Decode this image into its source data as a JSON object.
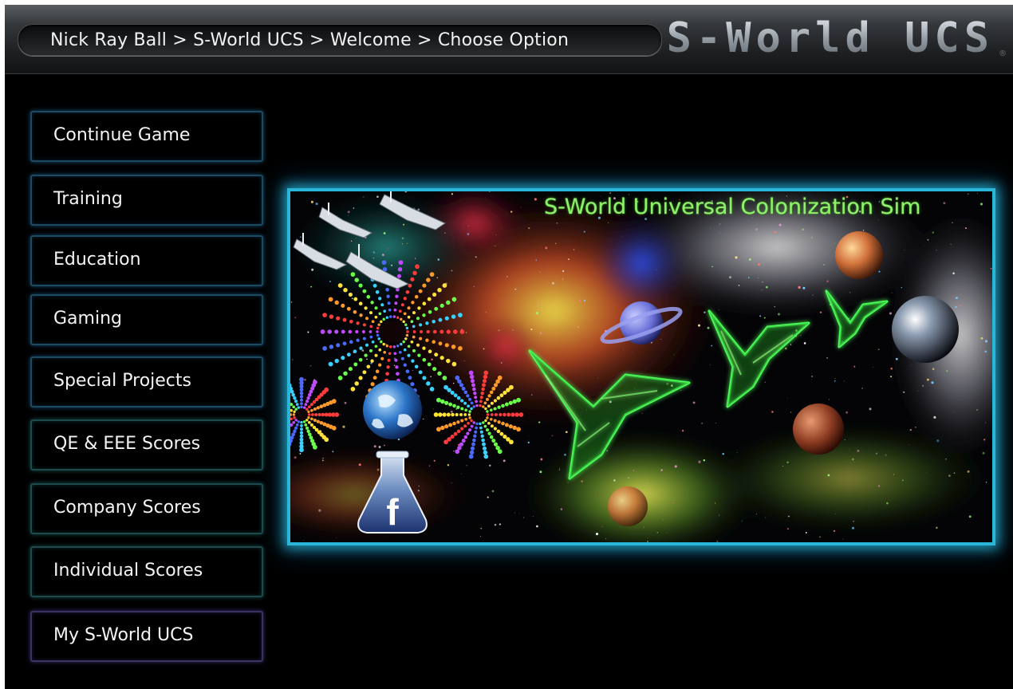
{
  "header": {
    "breadcrumb": "Nick Ray Ball > S-World UCS > Welcome > Choose Option",
    "logo": "S-World UCS",
    "registered_mark": "®"
  },
  "menu": [
    {
      "label": "Continue Game"
    },
    {
      "label": "Training"
    },
    {
      "label": "Education"
    },
    {
      "label": "Gaming"
    },
    {
      "label": "Special Projects"
    },
    {
      "label": "QE & EEE Scores"
    },
    {
      "label": "Company Scores"
    },
    {
      "label": "Individual Scores"
    },
    {
      "label": "My S-World UCS"
    }
  ],
  "banner": {
    "title": "S-World Universal Colonization Sim",
    "facebook_glyph": "f"
  },
  "colors": {
    "accent_glow": "#2ab6d8",
    "banner_title": "#8cf06a",
    "background": "#000000"
  }
}
